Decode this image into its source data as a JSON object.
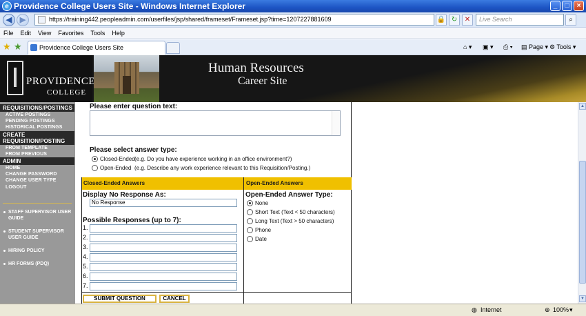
{
  "window": {
    "title": "Providence College Users Site - Windows Internet Explorer"
  },
  "browser": {
    "url": "https://training442.peopleadmin.com/userfiles/jsp/shared/frameset/Frameset.jsp?time=1207227881609",
    "search_placeholder": "Live Search",
    "menu": [
      "File",
      "Edit",
      "View",
      "Favorites",
      "Tools",
      "Help"
    ],
    "tab_title": "Providence College Users Site",
    "page_menu": "Page",
    "tools_menu": "Tools"
  },
  "header": {
    "logo_name": "PROVIDENCE",
    "logo_sub": "COLLEGE",
    "title_line1": "Human Resources",
    "title_line2": "Career Site"
  },
  "sidebar": {
    "sections": [
      {
        "title": "REQUISITIONS/POSTINGS",
        "items": [
          "ACTIVE POSTINGS",
          "PENDING POSTINGS",
          "HISTORICAL POSTINGS"
        ]
      },
      {
        "title": "CREATE REQUISITION/POSTING",
        "items": [
          "FROM TEMPLATE",
          "FROM PREVIOUS"
        ]
      },
      {
        "title": "ADMIN",
        "items": [
          "HOME",
          "CHANGE PASSWORD",
          "CHANGE USER TYPE",
          "LOGOUT"
        ]
      }
    ],
    "guides": [
      "STAFF SUPERVISOR USER GUIDE",
      "STUDENT SUPERVISOR USER GUIDE",
      "HIRING POLICY",
      "HR FORMS (PDQ)"
    ]
  },
  "form": {
    "question_label": "Please enter question text:",
    "answer_type_label": "Please select answer type:",
    "answer_types": [
      {
        "name": "Closed-Ended",
        "example": "(e.g. Do you have experience working in an office environment?)",
        "selected": true
      },
      {
        "name": "Open-Ended",
        "example": "(e.g. Describe any work experience relevant to this Requisition/Posting.)",
        "selected": false
      }
    ],
    "closed_header": "Closed-Ended Answers",
    "open_header": "Open-Ended Answers",
    "display_no_response_label": "Display No Response As:",
    "no_response_value": "No Response",
    "possible_responses_label": "Possible Responses (up to 7):",
    "response_numbers": [
      "1.",
      "2.",
      "3.",
      "4.",
      "5.",
      "6.",
      "7."
    ],
    "open_type_label": "Open-Ended Answer Type:",
    "open_types": [
      {
        "name": "None",
        "selected": true
      },
      {
        "name": "Short Text (Text < 50 characters)",
        "selected": false
      },
      {
        "name": "Long Text (Text > 50 characters)",
        "selected": false
      },
      {
        "name": "Phone",
        "selected": false
      },
      {
        "name": "Date",
        "selected": false
      }
    ],
    "submit_label": "SUBMIT QUESTION",
    "cancel_label": "CANCEL"
  },
  "status": {
    "zone": "Internet",
    "zoom": "100%"
  }
}
